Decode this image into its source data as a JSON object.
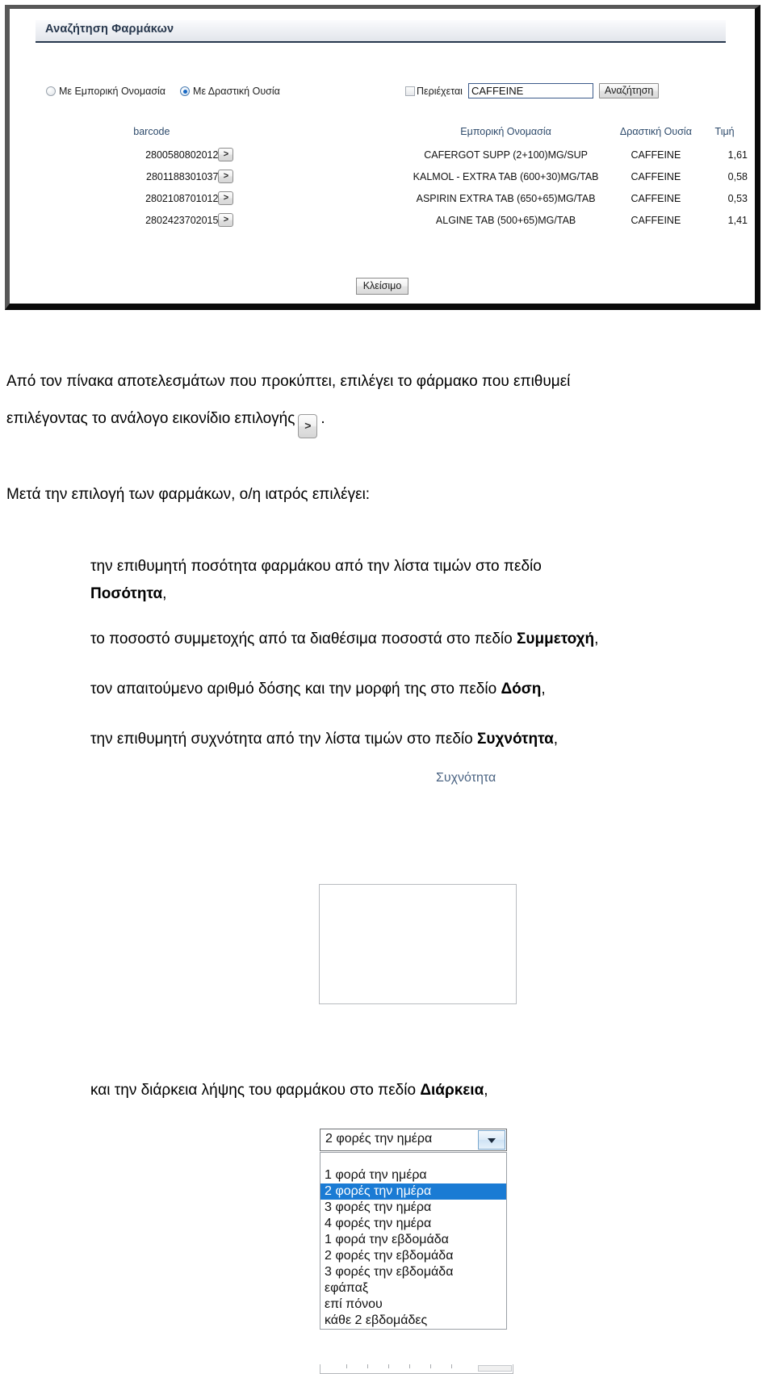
{
  "screenshot": {
    "panel_title": "Αναζήτηση Φαρμάκων",
    "search_mode": {
      "options": [
        {
          "label": "Με Εμπορική Ονομασία",
          "selected": false
        },
        {
          "label": "Με Δραστική Ουσία",
          "selected": true
        }
      ]
    },
    "contains_checkbox": {
      "label": "Περιέχεται",
      "checked": false
    },
    "search_field": {
      "value": "CAFFEINE",
      "placeholder": ""
    },
    "search_button": "Αναζήτηση",
    "close_button": "Κλείσιμο",
    "select_icon_glyph": ">",
    "table": {
      "headers": [
        "barcode",
        "Εμπορική Ονομασία",
        "Δραστική Ουσία",
        "Τιμή"
      ],
      "rows": [
        {
          "barcode": "2800580802012",
          "trade_name": "CAFERGOT SUPP (2+100)MG/SUP",
          "substance": "CAFFEINE",
          "price": "1,61"
        },
        {
          "barcode": "2801188301037",
          "trade_name": "KALMOL - EXTRA TAB (600+30)MG/TAB",
          "substance": "CAFFEINE",
          "price": "0,58"
        },
        {
          "barcode": "2802108701012",
          "trade_name": "ASPIRIN EXTRA TAB (650+65)MG/TAB",
          "substance": "CAFFEINE",
          "price": "0,53"
        },
        {
          "barcode": "2802423702015",
          "trade_name": "ALGINE TAB (500+65)MG/TAB",
          "substance": "CAFFEINE",
          "price": "1,41"
        }
      ]
    }
  },
  "body_text": {
    "p1_a": "Από τον πίνακα αποτελεσμάτων που προκύπτει, επιλέγει το φάρμακο που επιθυμεί",
    "p1_b": "επιλέγοντας το ανάλογο εικονίδιο επιλογής",
    "p1_c": ".",
    "p2": "Μετά την επιλογή των φαρμάκων, ο/η ιατρός επιλέγει:",
    "bullets": [
      {
        "plain": "την επιθυμητή ποσότητα φαρμάκου από την λίστα τιμών στο πεδίο ",
        "bold": "Ποσότητα",
        "tail": ","
      },
      {
        "plain": "το ποσοστό συμμετοχής από τα διαθέσιμα ποσοστά στο πεδίο ",
        "bold": "Συμμετοχή",
        "tail": ","
      },
      {
        "plain": "τον απαιτούμενο αριθμό δόσης και την μορφή της στο πεδίο ",
        "bold": "Δόση",
        "tail": ","
      },
      {
        "plain": "την επιθυμητή συχνότητα από την λίστα τιμών στο πεδίο ",
        "bold": "Συχνότητα",
        "tail": ","
      }
    ],
    "last_plain": "και την διάρκεια λήψης του φαρμάκου στο πεδίο ",
    "last_bold": "Διάρκεια",
    "last_tail": ","
  },
  "frequency_widget": {
    "label": "Συχνότητα",
    "selected_value": "2 φορές την ημέρα",
    "options": [
      "1 φορά την ημέρα",
      "2 φορές την ημέρα",
      "3 φορές την ημέρα",
      "4 φορές την ημέρα",
      "1 φορά την εβδομάδα",
      "2 φορές την εβδομάδα",
      "3 φορές την εβδομάδα",
      "εφάπαξ",
      "επί πόνου",
      "κάθε 2 εβδομάδες"
    ],
    "selected_index": 1
  },
  "colors": {
    "title_blue": "#27374d",
    "header_blue": "#2d4a6b",
    "highlight_blue": "#1a7bd4",
    "label_blue": "#4a6382"
  }
}
